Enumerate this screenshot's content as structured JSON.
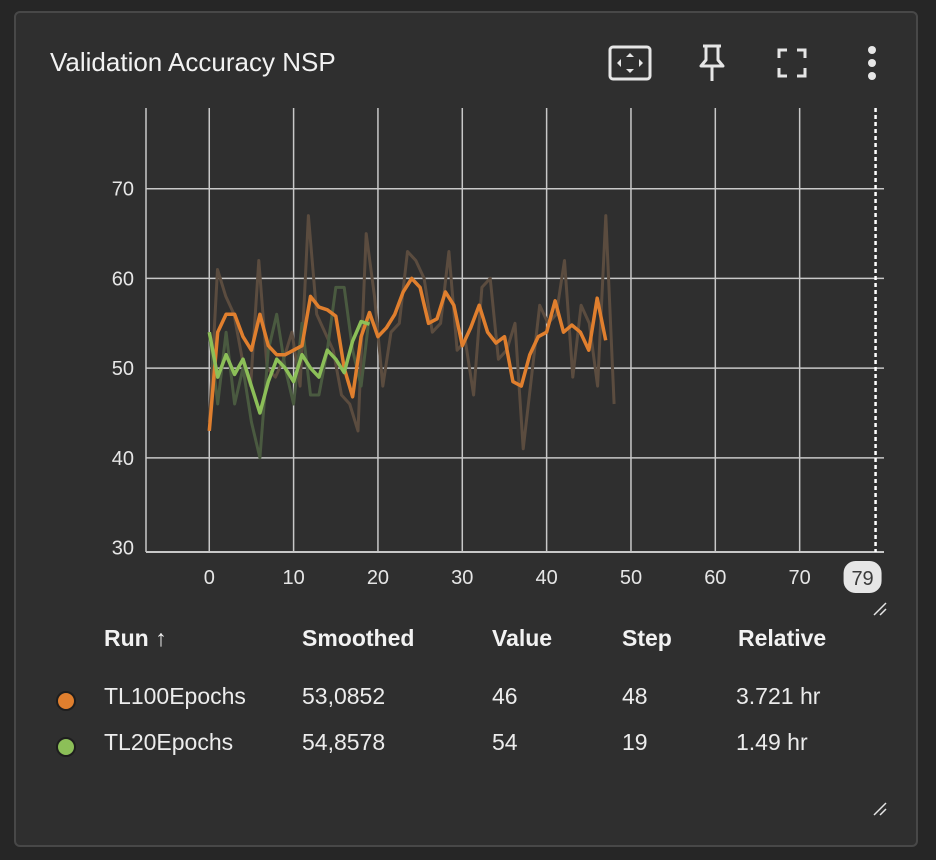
{
  "card": {
    "title": "Validation Accuracy NSP",
    "toolbar": {
      "fit_icon": "fit-domain-icon",
      "pin_icon": "pin-icon",
      "fullscreen_icon": "fullscreen-icon",
      "menu_icon": "more-vert-icon"
    }
  },
  "colors": {
    "background": "#2f2f2f",
    "grid": "#c8c8c8",
    "tl100_smoothed": "#e07f2e",
    "tl100_raw": "#5b4c3f",
    "tl20_smoothed": "#8cbf58",
    "tl20_raw": "#4a5a40"
  },
  "chart_data": {
    "type": "line",
    "xlabel": "",
    "ylabel": "",
    "xlim": [
      -7.5,
      80
    ],
    "ylim": [
      29.5,
      79
    ],
    "x_ticks": [
      0,
      10,
      20,
      30,
      40,
      50,
      60,
      70
    ],
    "y_ticks": [
      30,
      40,
      50,
      60,
      70
    ],
    "hover_x_label": "79",
    "grid": true,
    "series": [
      {
        "name": "TL100Epochs",
        "color": "#e07f2e",
        "raw_color": "#5b4c3f",
        "x": [
          0,
          1,
          2,
          3,
          4,
          5,
          6,
          7,
          8,
          9,
          10,
          11,
          12,
          13,
          14,
          15,
          16,
          17,
          18,
          19,
          20,
          21,
          22,
          23,
          24,
          25,
          26,
          27,
          28,
          29,
          30,
          31,
          32,
          33,
          34,
          35,
          36,
          37,
          38,
          39,
          40,
          41,
          42,
          43,
          44,
          45,
          46,
          47,
          48
        ],
        "raw": [
          44,
          61,
          58,
          56,
          51,
          48,
          62,
          50,
          49,
          51,
          54,
          48,
          67,
          56,
          54,
          52,
          47,
          46,
          43,
          65,
          58,
          48,
          54,
          55,
          63,
          62,
          60,
          54,
          55,
          63,
          52,
          53,
          47,
          59,
          60,
          51,
          52,
          55,
          41,
          49,
          57,
          55,
          56,
          62,
          49,
          57,
          55,
          48,
          67,
          46
        ],
        "smoothed": [
          43,
          54,
          56,
          56,
          53.5,
          52,
          56,
          52.5,
          51.5,
          51.5,
          52,
          52.5,
          58,
          56.8,
          56.5,
          55.8,
          50,
          46.8,
          53.5,
          56.2,
          53.5,
          54.5,
          56,
          58.5,
          60,
          59,
          55,
          55.5,
          58.5,
          57,
          52.5,
          54.5,
          57,
          54,
          52.8,
          53.5,
          48.5,
          48,
          51.5,
          53.5,
          54,
          57.5,
          54,
          54.8,
          54,
          52,
          57.8,
          53.1
        ],
        "table": {
          "smoothed": "53,0852",
          "value": "46",
          "step": "48",
          "relative": "3.721 hr"
        }
      },
      {
        "name": "TL20Epochs",
        "color": "#8cbf58",
        "raw_color": "#4a5a40",
        "x": [
          0,
          1,
          2,
          3,
          4,
          5,
          6,
          7,
          8,
          9,
          10,
          11,
          12,
          13,
          14,
          15,
          16,
          17,
          18,
          19
        ],
        "raw": [
          54,
          46,
          54,
          46,
          50,
          44,
          40,
          52,
          56,
          50,
          46,
          55,
          47,
          47,
          52,
          59,
          59,
          52,
          48,
          56
        ],
        "smoothed": [
          54,
          49,
          51.5,
          49.3,
          51,
          48,
          45,
          48.5,
          51,
          50,
          48.5,
          51.5,
          50,
          49,
          52,
          51,
          49.5,
          53,
          55.2,
          54.9
        ],
        "table": {
          "smoothed": "54,8578",
          "value": "54",
          "step": "19",
          "relative": "1.49 hr"
        }
      }
    ]
  },
  "table": {
    "headers": {
      "run": "Run ↑",
      "smoothed": "Smoothed",
      "value": "Value",
      "step": "Step",
      "relative": "Relative"
    },
    "rows": [
      {
        "run": "TL100Epochs",
        "color": "#e07f2e",
        "smoothed": "53,0852",
        "value": "46",
        "step": "48",
        "relative": "3.721 hr"
      },
      {
        "run": "TL20Epochs",
        "color": "#8cbf58",
        "smoothed": "54,8578",
        "value": "54",
        "step": "19",
        "relative": "1.49 hr"
      }
    ]
  }
}
